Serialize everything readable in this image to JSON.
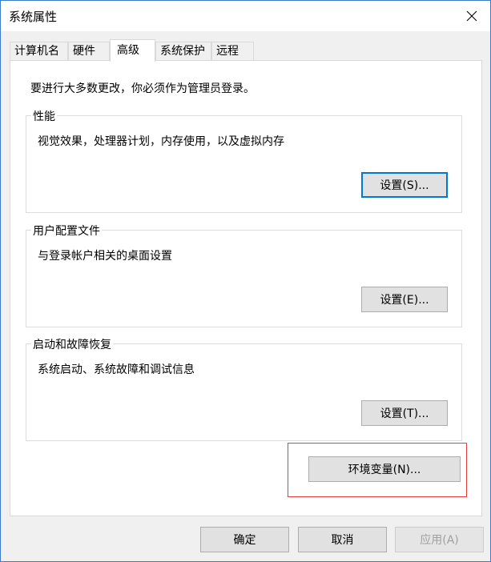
{
  "window": {
    "title": "系统属性"
  },
  "tabs": [
    {
      "label": "计算机名"
    },
    {
      "label": "硬件"
    },
    {
      "label": "高级"
    },
    {
      "label": "系统保护"
    },
    {
      "label": "远程"
    }
  ],
  "advanced": {
    "admin_note": "要进行大多数更改，你必须作为管理员登录。",
    "performance": {
      "title": "性能",
      "description": "视觉效果，处理器计划，内存使用，以及虚拟内存",
      "button": "设置(S)..."
    },
    "user_profiles": {
      "title": "用户配置文件",
      "description": "与登录帐户相关的桌面设置",
      "button": "设置(E)..."
    },
    "startup_recovery": {
      "title": "启动和故障恢复",
      "description": "系统启动、系统故障和调试信息",
      "button": "设置(T)..."
    },
    "env_button": "环境变量(N)..."
  },
  "footer": {
    "ok": "确定",
    "cancel": "取消",
    "apply": "应用(A)"
  },
  "colors": {
    "accent": "#0078d7",
    "highlight": "#e53c3c",
    "window_border": "#3f79c9"
  },
  "icons": {
    "close": "close-icon"
  }
}
